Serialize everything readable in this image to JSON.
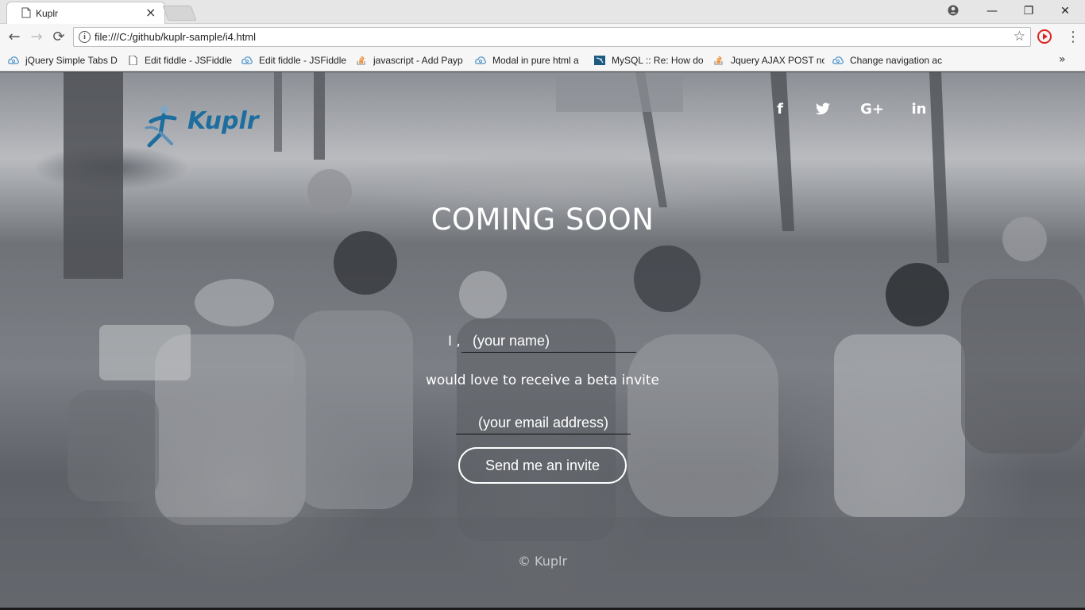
{
  "browser": {
    "tab": {
      "title": "Kuplr",
      "close_glyph": "×"
    },
    "window_controls": {
      "minimize": "—",
      "maximize": "❐",
      "close": "✕"
    },
    "nav": {
      "back": "←",
      "forward": "→",
      "reload": "⟳"
    },
    "address": {
      "info": "i",
      "url": "file:///C:/github/kuplr-sample/i4.html",
      "star": "☆"
    },
    "menu_glyph": "⋮",
    "bookmarks": [
      {
        "label": "jQuery Simple Tabs D",
        "icon": "jsfiddle-cloud-icon"
      },
      {
        "label": "Edit fiddle - JSFiddle",
        "icon": "document-icon"
      },
      {
        "label": "Edit fiddle - JSFiddle",
        "icon": "jsfiddle-cloud-icon"
      },
      {
        "label": "javascript - Add Payp",
        "icon": "stackoverflow-icon"
      },
      {
        "label": "Modal in pure html a",
        "icon": "jsfiddle-cloud-icon"
      },
      {
        "label": "MySQL :: Re: How do",
        "icon": "mysql-icon"
      },
      {
        "label": "Jquery AJAX POST no",
        "icon": "stackoverflow-icon"
      },
      {
        "label": "Change navigation ac",
        "icon": "jsfiddle-cloud-icon"
      }
    ],
    "bookmarks_more": "»"
  },
  "page": {
    "logo_text": "Kuplr",
    "social": [
      {
        "glyph": "f",
        "icon": "facebook-icon"
      },
      {
        "glyph": "🐦",
        "icon": "twitter-icon"
      },
      {
        "glyph": "G+",
        "icon": "google-plus-icon"
      },
      {
        "glyph": "in",
        "icon": "linkedin-icon"
      }
    ],
    "headline": "COMING SOON",
    "form": {
      "name_prefix": "I ,",
      "name_placeholder": "(your name)",
      "invite_text": "would love to receive a beta invite",
      "email_placeholder": "(your email address)",
      "submit_label": "Send me an invite"
    },
    "footer": "© Kuplr"
  }
}
